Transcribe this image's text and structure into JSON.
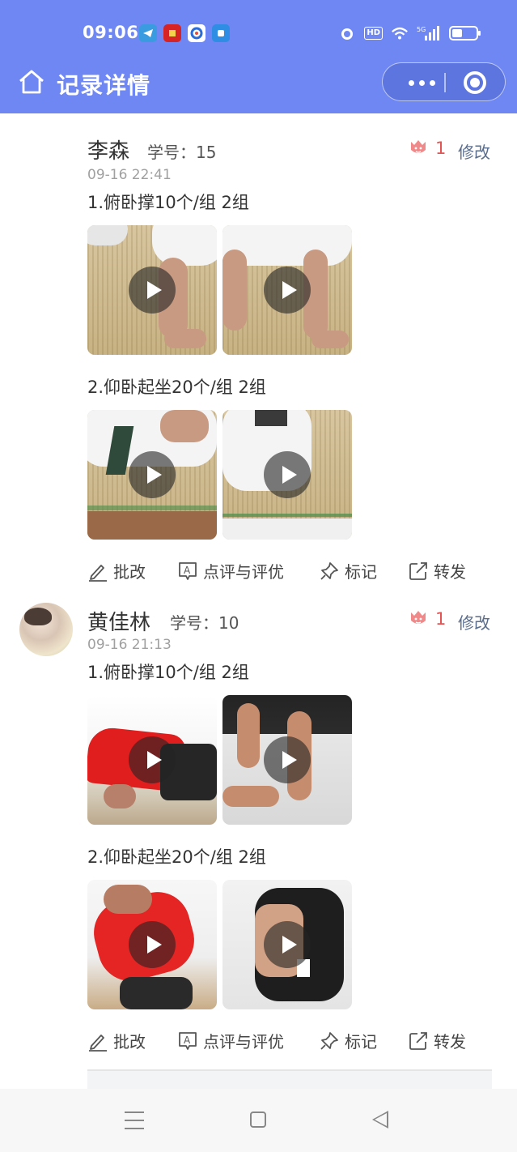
{
  "status_bar": {
    "time": "09:06",
    "network": "5G"
  },
  "header": {
    "title": "记录详情"
  },
  "records": [
    {
      "name": "李森",
      "student_id_label": "学号：15",
      "flower_count": "1",
      "modify_label": "修改",
      "time": "09-16 22:41",
      "tasks": [
        {
          "label": "1.俯卧撑10个/组 2组"
        },
        {
          "label": "2.仰卧起坐20个/组 2组"
        }
      ]
    },
    {
      "name": "黄佳林",
      "student_id_label": "学号：10",
      "flower_count": "1",
      "modify_label": "修改",
      "time": "09-16 21:13",
      "tasks": [
        {
          "label": "1.俯卧撑10个/组 2组"
        },
        {
          "label": "2.仰卧起坐20个/组 2组"
        }
      ]
    }
  ],
  "actions": {
    "correct": "批改",
    "comment": "点评与评优",
    "mark": "标记",
    "forward": "转发"
  },
  "colors": {
    "header_bg": "#6f87f3",
    "flower": "#e35454",
    "link": "#5a6d8d"
  }
}
